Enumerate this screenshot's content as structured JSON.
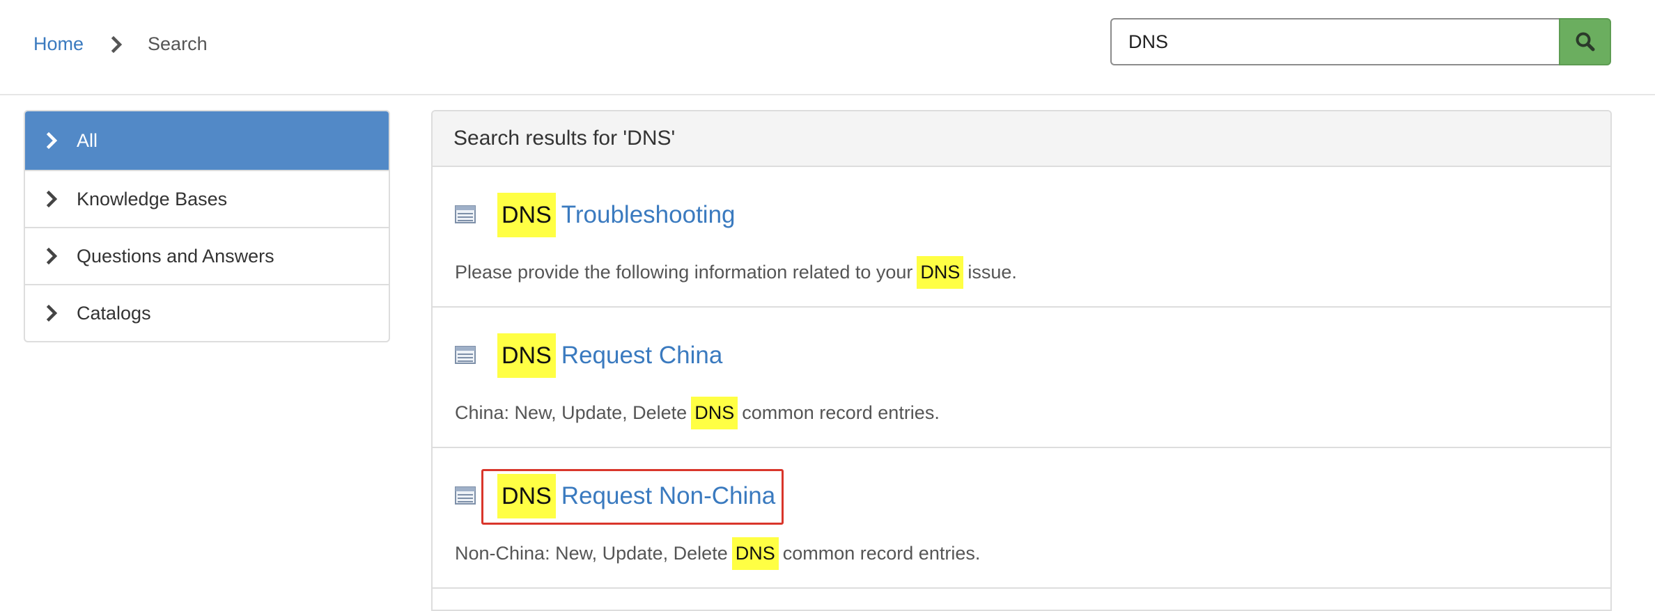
{
  "breadcrumb": {
    "home": "Home",
    "current": "Search"
  },
  "search": {
    "value": "DNS",
    "button_icon": "search-icon"
  },
  "colors": {
    "link": "#3a7abf",
    "active_sidebar": "#5289c7",
    "search_button": "#6bae5f",
    "highlight": "#ffff44",
    "focus_box": "#d9362b"
  },
  "sidebar": {
    "items": [
      {
        "label": "All",
        "active": true
      },
      {
        "label": "Knowledge Bases",
        "active": false
      },
      {
        "label": "Questions and Answers",
        "active": false
      },
      {
        "label": "Catalogs",
        "active": false
      }
    ]
  },
  "results": {
    "header": "Search results for 'DNS'",
    "items": [
      {
        "highlight": "DNS",
        "title": "Troubleshooting",
        "desc_before": "Please provide the following information related to your",
        "desc_highlight": "DNS",
        "desc_after": "issue.",
        "icon": "catalog-item-icon"
      },
      {
        "highlight": "DNS",
        "title": "Request China",
        "desc_before": "China: New, Update, Delete",
        "desc_highlight": "DNS",
        "desc_after": "common record entries.",
        "icon": "catalog-item-icon"
      },
      {
        "highlight": "DNS",
        "title": "Request Non-China",
        "desc_before": "Non-China: New, Update, Delete",
        "desc_highlight": "DNS",
        "desc_after": "common record entries.",
        "icon": "catalog-item-icon",
        "outlined": true
      }
    ]
  }
}
